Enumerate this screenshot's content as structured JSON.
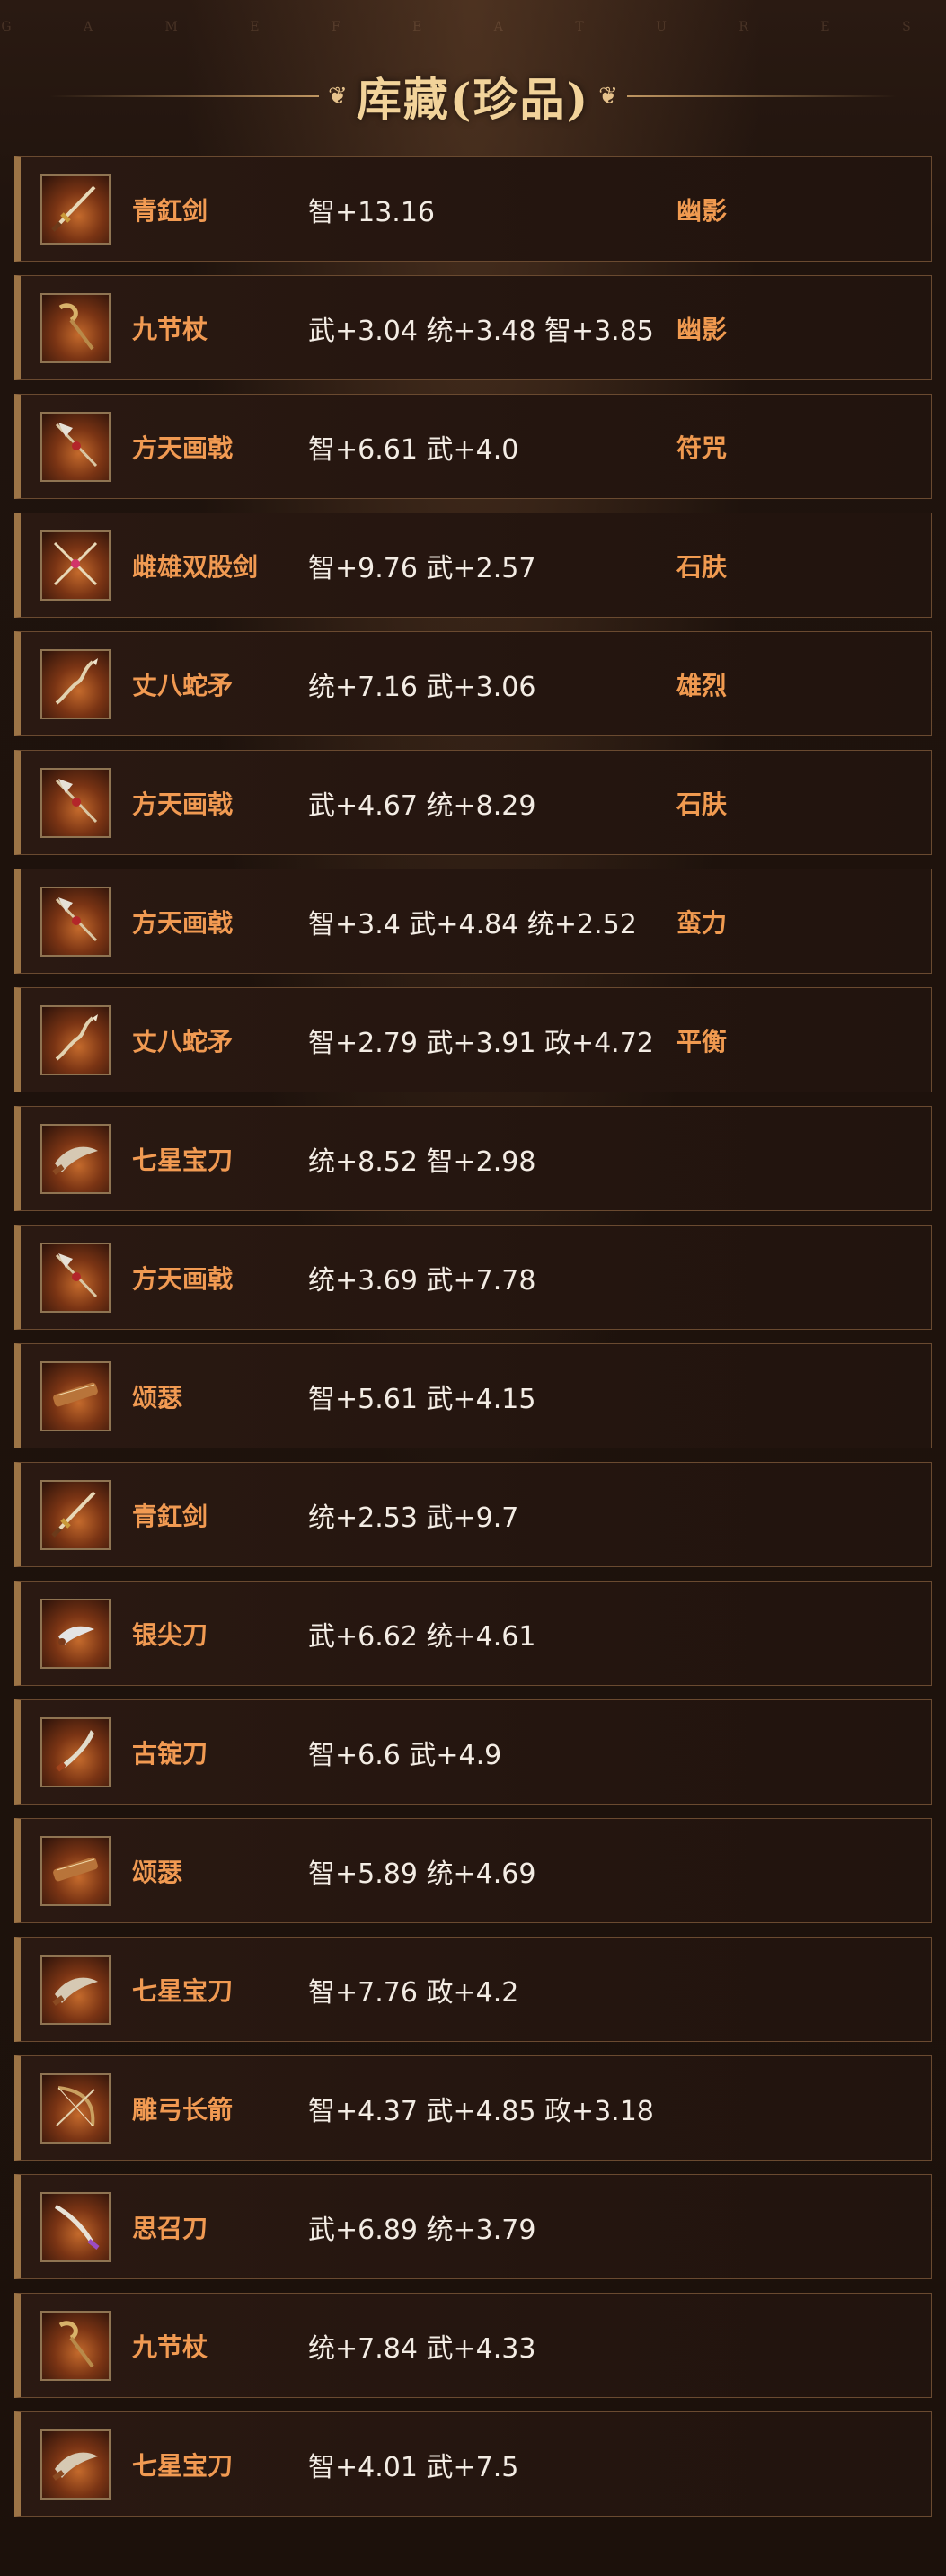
{
  "header": {
    "subtitle": "G A M E   F E A T U R E S",
    "title": "库藏(珍品)"
  },
  "colors": {
    "accent": "#f19a52",
    "title": "#f2d39a",
    "stats_text": "#f3ece4",
    "row_border": "#6a4a30"
  },
  "items": [
    {
      "name": "青釭剑",
      "stats": "智+13.16",
      "trait": "幽影",
      "icon": "sword-icon"
    },
    {
      "name": "九节杖",
      "stats": "武+3.04 统+3.48 智+3.85",
      "trait": "幽影",
      "icon": "staff-icon"
    },
    {
      "name": "方天画戟",
      "stats": "智+6.61 武+4.0",
      "trait": "符咒",
      "icon": "halberd-icon"
    },
    {
      "name": "雌雄双股剑",
      "stats": "智+9.76 武+2.57",
      "trait": "石肤",
      "icon": "twin-swords-icon"
    },
    {
      "name": "丈八蛇矛",
      "stats": "统+7.16 武+3.06",
      "trait": "雄烈",
      "icon": "serpent-spear-icon"
    },
    {
      "name": "方天画戟",
      "stats": "武+4.67 统+8.29",
      "trait": "石肤",
      "icon": "halberd-icon"
    },
    {
      "name": "方天画戟",
      "stats": "智+3.4 武+4.84 统+2.52",
      "trait": "蛮力",
      "icon": "halberd-icon"
    },
    {
      "name": "丈八蛇矛",
      "stats": "智+2.79 武+3.91 政+4.72",
      "trait": "平衡",
      "icon": "serpent-spear-icon"
    },
    {
      "name": "七星宝刀",
      "stats": "统+8.52 智+2.98",
      "trait": "",
      "icon": "blade-icon"
    },
    {
      "name": "方天画戟",
      "stats": "统+3.69 武+7.78",
      "trait": "",
      "icon": "halberd-icon"
    },
    {
      "name": "颂瑟",
      "stats": "智+5.61 武+4.15",
      "trait": "",
      "icon": "zither-icon"
    },
    {
      "name": "青釭剑",
      "stats": "统+2.53 武+9.7",
      "trait": "",
      "icon": "sword-icon"
    },
    {
      "name": "银尖刀",
      "stats": "武+6.62 统+4.61",
      "trait": "",
      "icon": "silver-blade-icon"
    },
    {
      "name": "古锭刀",
      "stats": "智+6.6 武+4.9",
      "trait": "",
      "icon": "saber-icon"
    },
    {
      "name": "颂瑟",
      "stats": "智+5.89 统+4.69",
      "trait": "",
      "icon": "zither-icon"
    },
    {
      "name": "七星宝刀",
      "stats": "智+7.76 政+4.2",
      "trait": "",
      "icon": "blade-icon"
    },
    {
      "name": "雕弓长箭",
      "stats": "智+4.37 武+4.85 政+3.18",
      "trait": "",
      "icon": "bow-icon"
    },
    {
      "name": "思召刀",
      "stats": "武+6.89 统+3.79",
      "trait": "",
      "icon": "curved-blade-icon"
    },
    {
      "name": "九节杖",
      "stats": "统+7.84 武+4.33",
      "trait": "",
      "icon": "staff-icon"
    },
    {
      "name": "七星宝刀",
      "stats": "智+4.01 武+7.5",
      "trait": "",
      "icon": "blade-icon"
    }
  ]
}
